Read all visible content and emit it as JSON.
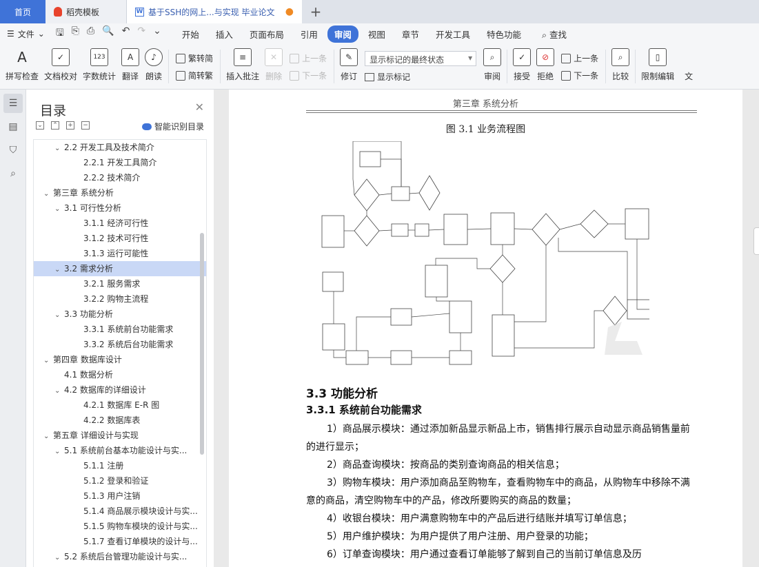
{
  "tabs": {
    "home": "首页",
    "templates": "稻壳模板",
    "doc": "基于SSH的网上...与实现 毕业论文",
    "doc_modified_marker": "●",
    "new_tab": "+"
  },
  "menu": {
    "file": "文件",
    "items": [
      "开始",
      "插入",
      "页面布局",
      "引用",
      "审阅",
      "视图",
      "章节",
      "开发工具",
      "特色功能"
    ],
    "active": "审阅",
    "search": "查找"
  },
  "ribbon": {
    "spell_check": "拼写检查",
    "proofread": "文档校对",
    "word_count": "字数统计",
    "translate": "翻译",
    "read_aloud": "朗读",
    "trad_convert": "繁转简",
    "simp_convert": "简转繁",
    "insert_comment": "插入批注",
    "delete": "删除",
    "prev_comment": "上一条",
    "next_comment": "下一条",
    "revise": "修订",
    "markup_state": "显示标记的最终状态",
    "show_markup": "显示标记",
    "review": "审阅",
    "accept": "接受",
    "reject": "拒绝",
    "prev_change": "上一条",
    "next_change": "下一条",
    "compare": "比较",
    "restrict_edit": "限制编辑",
    "last_cut": "文"
  },
  "toc": {
    "title": "目录",
    "smart": "智能识别目录",
    "items": [
      {
        "level": 2,
        "text": "2.2  开发工具及技术简介",
        "caret": true
      },
      {
        "level": 3,
        "text": "2.2.1  开发工具简介"
      },
      {
        "level": 3,
        "text": "2.2.2  技术简介"
      },
      {
        "level": 1,
        "text": "第三章  系统分析",
        "caret": true
      },
      {
        "level": 2,
        "text": "3.1  可行性分析",
        "caret": true
      },
      {
        "level": 3,
        "text": "3.1.1  经济可行性"
      },
      {
        "level": 3,
        "text": "3.1.2  技术可行性"
      },
      {
        "level": 3,
        "text": "3.1.3  运行可能性"
      },
      {
        "level": 2,
        "text": "3.2  需求分析",
        "caret": true,
        "selected": true
      },
      {
        "level": 3,
        "text": "3.2.1  服务需求"
      },
      {
        "level": 3,
        "text": "3.2.2  购物主流程"
      },
      {
        "level": 2,
        "text": "3.3  功能分析",
        "caret": true
      },
      {
        "level": 3,
        "text": "3.3.1  系统前台功能需求"
      },
      {
        "level": 3,
        "text": "3.3.2  系统后台功能需求"
      },
      {
        "level": 1,
        "text": "第四章  数据库设计",
        "caret": true
      },
      {
        "level": 2,
        "text": "4.1  数据分析"
      },
      {
        "level": 2,
        "text": "4.2  数据库的详细设计",
        "caret": true
      },
      {
        "level": 3,
        "text": "4.2.1  数据库 E-R 图"
      },
      {
        "level": 3,
        "text": "4.2.2  数据库表"
      },
      {
        "level": 1,
        "text": "第五章  详细设计与实现",
        "caret": true
      },
      {
        "level": 2,
        "text": "5.1  系统前台基本功能设计与实...",
        "caret": true
      },
      {
        "level": 3,
        "text": "5.1.1  注册"
      },
      {
        "level": 3,
        "text": "5.1.2  登录和验证"
      },
      {
        "level": 3,
        "text": "5.1.3  用户注销"
      },
      {
        "level": 3,
        "text": "5.1.4  商品展示模块设计与实..."
      },
      {
        "level": 3,
        "text": "5.1.5  购物车模块的设计与实..."
      },
      {
        "level": 3,
        "text": "5.1.7  查看订单模块的设计与..."
      },
      {
        "level": 2,
        "text": "5.2  系统后台管理功能设计与实...",
        "caret": true
      }
    ]
  },
  "document": {
    "running_header": "第三章  系统分析",
    "figure_caption": "图 3.1  业务流程图",
    "section_title": "3.3  功能分析",
    "subsection_title": "3.3.1    系统前台功能需求",
    "paragraphs": [
      "1）商品展示模块：通过添加新品显示新品上市，销售排行展示自动显示商品销售量前的进行显示；",
      "2）商品查询模块：按商品的类别查询商品的相关信息；",
      "3）购物车模块：用户添加商品至购物车，查看购物车中的商品，从购物车中移除不满意的商品，清空购物车中的产品，修改所要购买的商品的数量；",
      "4）收银台模块：用户满意购物车中的产品后进行结账并填写订单信息；",
      "5）用户维护模块：为用户提供了用户注册、用户登录的功能；",
      "6）订单查询模块：用户通过查看订单能够了解到自己的当前订单信息及历"
    ]
  }
}
